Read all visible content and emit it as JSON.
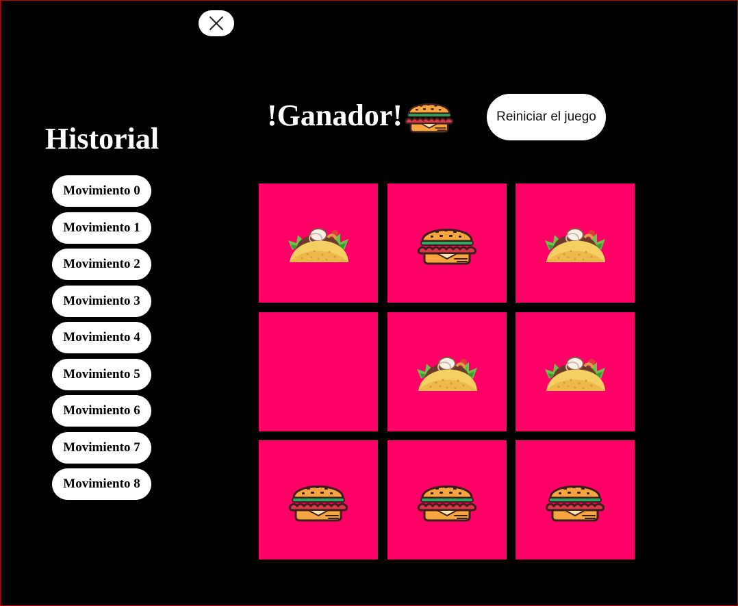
{
  "close": {
    "icon": "close-icon"
  },
  "history": {
    "title": "Historial",
    "moves": [
      "Movimiento 0",
      "Movimiento 1",
      "Movimiento 2",
      "Movimiento 3",
      "Movimiento 4",
      "Movimiento 5",
      "Movimiento 6",
      "Movimiento 7",
      "Movimiento 8"
    ]
  },
  "status": {
    "text": "!Ganador!",
    "winner": "burger"
  },
  "restart": {
    "label": "Reiniciar el juego"
  },
  "board": {
    "cell_color": "#ff0066",
    "cells": [
      "taco",
      "burger",
      "taco",
      "",
      "taco",
      "taco",
      "burger",
      "burger",
      "burger"
    ]
  },
  "icons": {
    "burger": "burger-icon",
    "taco": "taco-icon"
  }
}
